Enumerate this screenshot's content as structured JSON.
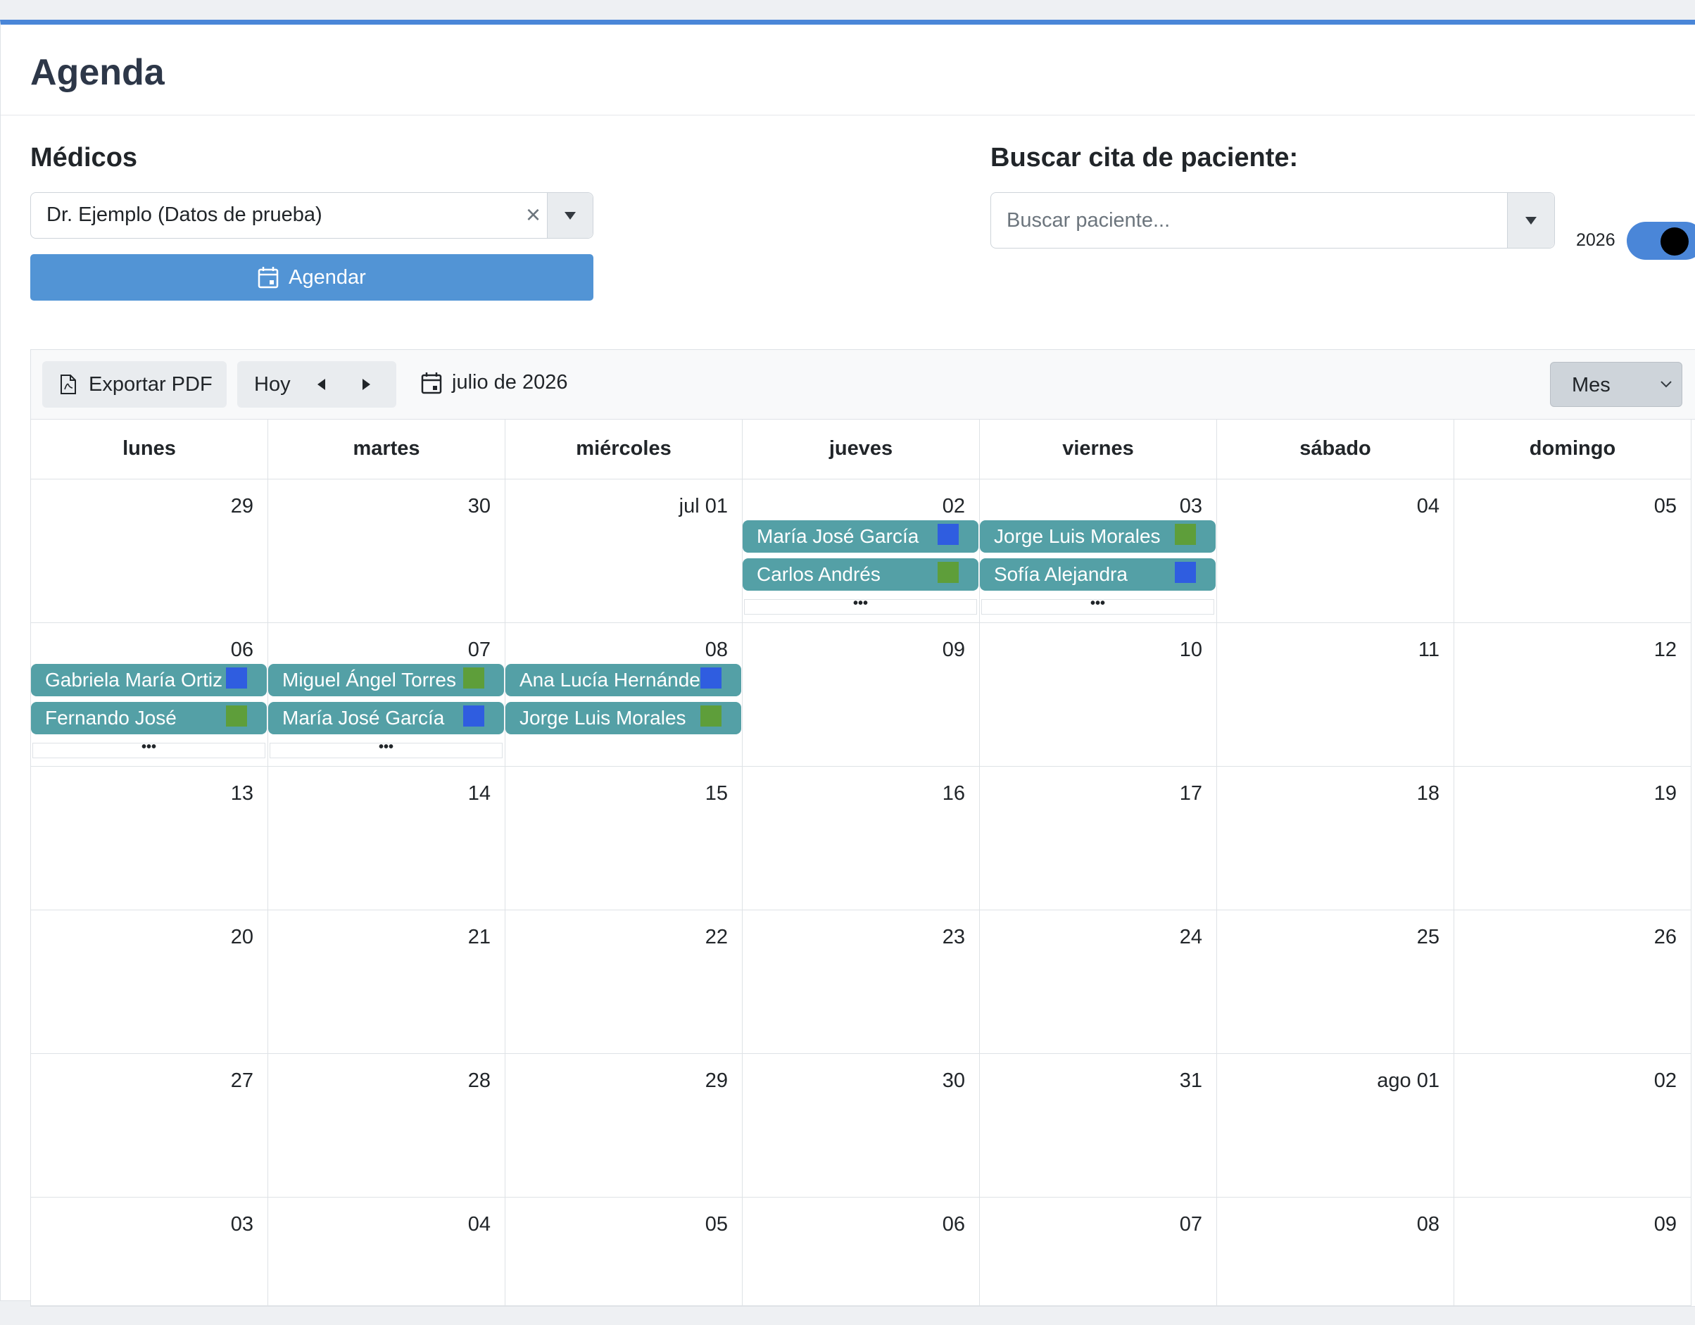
{
  "page": {
    "title": "Agenda"
  },
  "doctors": {
    "label": "Médicos",
    "selected": "Dr. Ejemplo (Datos de prueba)",
    "clear_glyph": "×",
    "schedule_button": "Agendar"
  },
  "patient_search": {
    "label": "Buscar cita de paciente:",
    "placeholder": "Buscar paciente...",
    "year_label": "2026",
    "year_toggle_on": true
  },
  "calendar": {
    "toolbar": {
      "export_pdf": "Exportar PDF",
      "today": "Hoy",
      "current_period": "julio de 2026",
      "view": "Mes"
    },
    "weekdays": [
      "lunes",
      "martes",
      "miércoles",
      "jueves",
      "viernes",
      "sábado",
      "domingo"
    ],
    "weeks": [
      [
        "29",
        "30",
        "jul 01",
        "02",
        "03",
        "04",
        "05"
      ],
      [
        "06",
        "07",
        "08",
        "09",
        "10",
        "11",
        "12"
      ],
      [
        "13",
        "14",
        "15",
        "16",
        "17",
        "18",
        "19"
      ],
      [
        "20",
        "21",
        "22",
        "23",
        "24",
        "25",
        "26"
      ],
      [
        "27",
        "28",
        "29",
        "30",
        "31",
        "ago 01",
        "02"
      ],
      [
        "03",
        "04",
        "05",
        "06",
        "07",
        "08",
        "09"
      ]
    ],
    "events": [
      {
        "week": 0,
        "day": 3,
        "slot": 0,
        "name": "María José García",
        "marker_color": "#2f5de0"
      },
      {
        "week": 0,
        "day": 3,
        "slot": 1,
        "name": "Carlos Andrés",
        "marker_color": "#5e9e3a"
      },
      {
        "week": 0,
        "day": 4,
        "slot": 0,
        "name": "Jorge Luis Morales",
        "marker_color": "#5e9e3a"
      },
      {
        "week": 0,
        "day": 4,
        "slot": 1,
        "name": "Sofía Alejandra",
        "marker_color": "#2f5de0"
      },
      {
        "week": 1,
        "day": 0,
        "slot": 0,
        "name": "Gabriela María Ortiz",
        "marker_color": "#2f5de0"
      },
      {
        "week": 1,
        "day": 0,
        "slot": 1,
        "name": "Fernando José",
        "marker_color": "#5e9e3a"
      },
      {
        "week": 1,
        "day": 1,
        "slot": 0,
        "name": "Miguel Ángel Torres",
        "marker_color": "#5e9e3a"
      },
      {
        "week": 1,
        "day": 1,
        "slot": 1,
        "name": "María José García",
        "marker_color": "#2f5de0"
      },
      {
        "week": 1,
        "day": 2,
        "slot": 0,
        "name": "Ana Lucía Hernández",
        "marker_color": "#2f5de0"
      },
      {
        "week": 1,
        "day": 2,
        "slot": 1,
        "name": "Jorge Luis Morales",
        "marker_color": "#5e9e3a"
      }
    ],
    "more_links": [
      {
        "week": 0,
        "day": 3,
        "label": "•••"
      },
      {
        "week": 0,
        "day": 4,
        "label": "•••"
      },
      {
        "week": 1,
        "day": 0,
        "label": "•••"
      },
      {
        "week": 1,
        "day": 1,
        "label": "•••"
      }
    ]
  },
  "colors": {
    "accent": "#4a86d8",
    "primary_button": "#5294d5",
    "event_bg": "#54a0a6"
  }
}
